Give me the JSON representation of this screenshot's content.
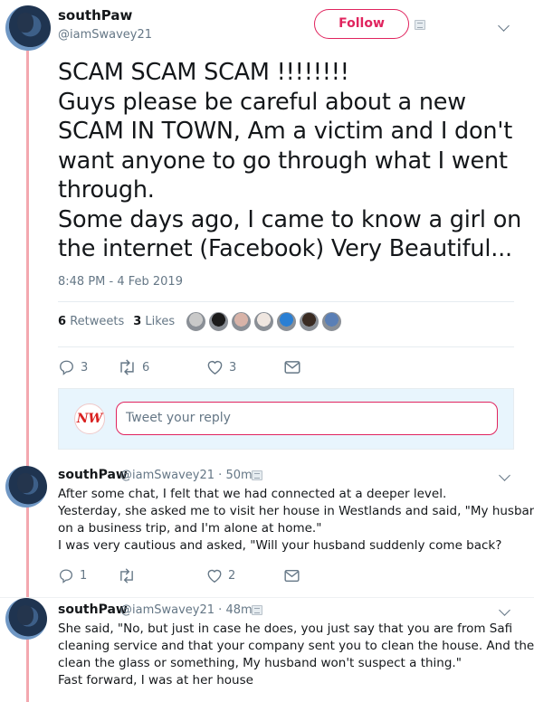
{
  "main_tweet": {
    "display_name": "southPaw",
    "handle": "@iamSwavey21",
    "follow_label": "Follow",
    "text_lines": [
      "SCAM SCAM SCAM !!!!!!!!",
      "Guys please be careful about a new",
      "SCAM IN TOWN, Am a victim and I don't",
      "want anyone to go through what I went",
      "through.",
      "Some days ago, I came to know a girl on",
      "the internet (Facebook) Very Beautiful..."
    ],
    "timestamp": "8:48 PM - 4 Feb 2019",
    "retweets_count": "6",
    "retweets_label": "Retweets",
    "likes_count": "3",
    "likes_label": "Likes",
    "liker_colors": [
      "#c9c9c9",
      "#1b1b1b",
      "#d8b3a8",
      "#efe6e0",
      "#2a7fd4",
      "#3a2b22",
      "#5a7fb6"
    ],
    "actions": {
      "replies": "3",
      "retweets": "6",
      "likes": "3"
    }
  },
  "reply_box": {
    "logo_text": "NW",
    "placeholder": "Tweet your reply"
  },
  "replies": [
    {
      "display_name": "southPaw",
      "handle": "@iamSwavey21",
      "time": "50m",
      "lines": [
        "After some chat, I felt that we had connected at a deeper level.",
        "Yesterday, she asked me to visit her house in Westlands and said, \"My husband is",
        "on a business trip, and I'm alone at home.\"",
        "I was very cautious and asked, \"Will your husband suddenly come back?"
      ],
      "actions": {
        "replies": "1",
        "retweets": "",
        "likes": "2"
      }
    },
    {
      "display_name": "southPaw",
      "handle": "@iamSwavey21",
      "time": "48m",
      "lines": [
        "She said, \"No, but just in case he does, you just say that you are from Safi",
        "cleaning service and that your company sent you to clean the house. And then,",
        "clean the glass or something, My husband won't suspect a thing.\"",
        "Fast forward, I was at her house"
      ]
    }
  ],
  "colors": {
    "accent": "#e0245e",
    "thread_line": "#f3a8af",
    "text_secondary": "#657786",
    "reply_area_bg": "#e8f5fd"
  }
}
